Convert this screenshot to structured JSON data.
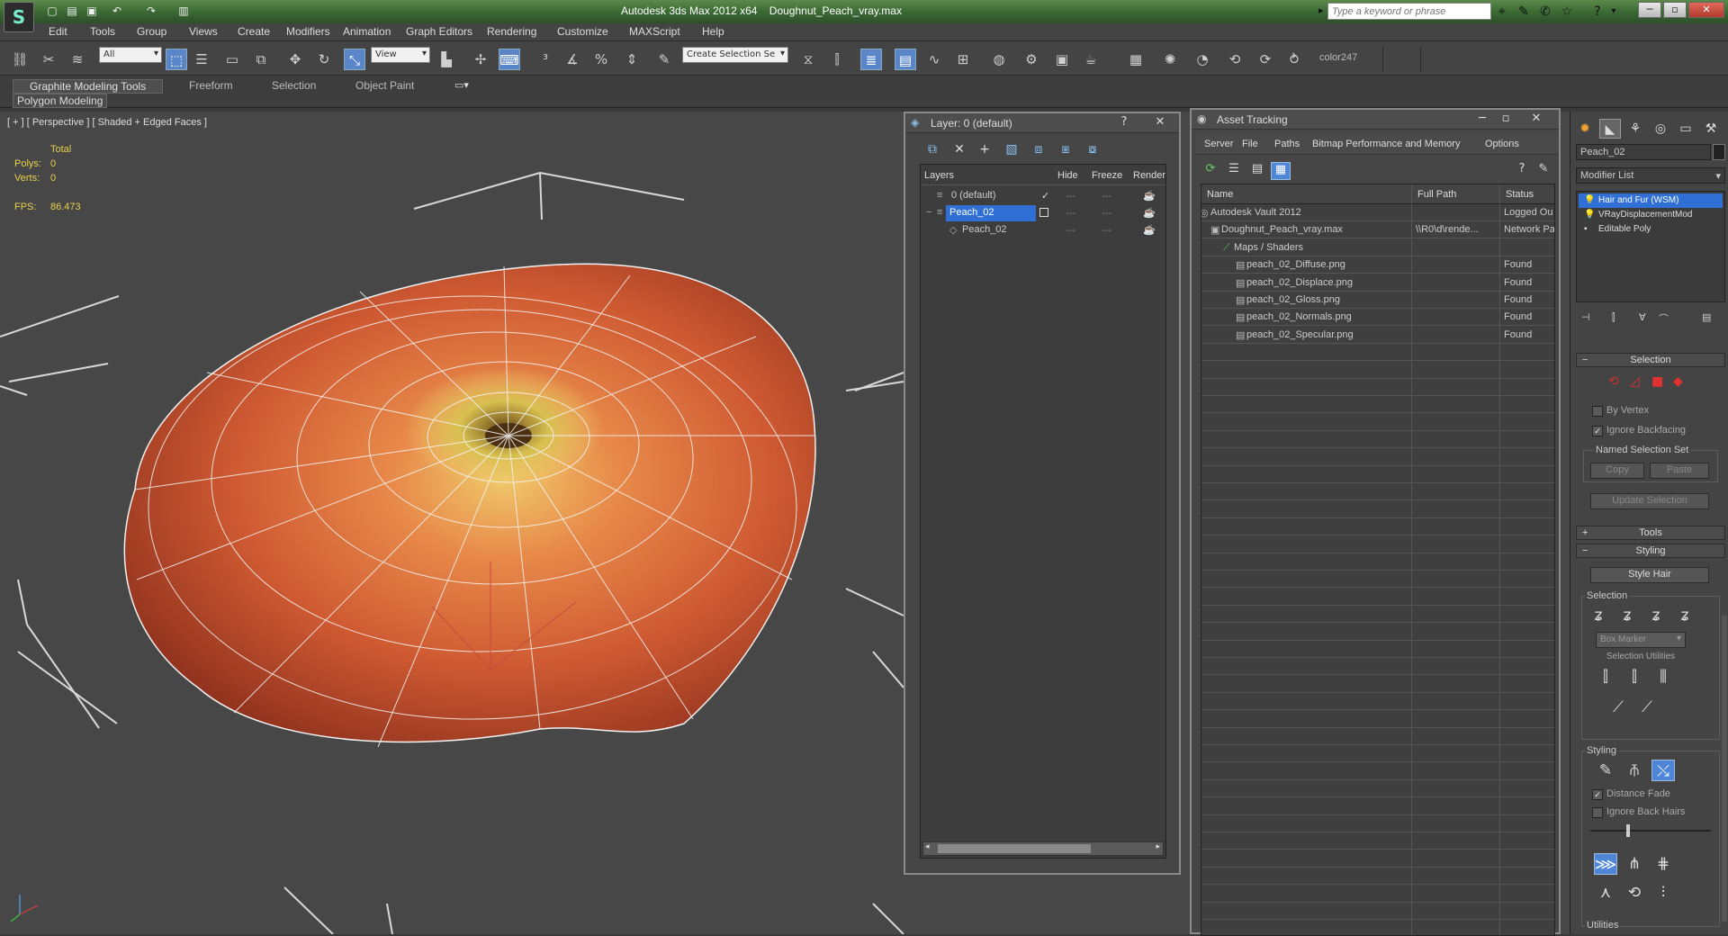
{
  "titlebar": {
    "app_title": "Autodesk 3ds Max  2012 x64",
    "file_name": "Doughnut_Peach_vray.max",
    "search_placeholder": "Type a keyword or phrase"
  },
  "menu": [
    "Edit",
    "Tools",
    "Group",
    "Views",
    "Create",
    "Modifiers",
    "Animation",
    "Graph Editors",
    "Rendering",
    "Customize",
    "MAXScript",
    "Help"
  ],
  "toolbar": {
    "selection_filter": "All",
    "ref_coord": "View",
    "named_selection": "Create Selection Se",
    "color_label": "color247"
  },
  "ribbon": {
    "tabs": [
      "Graphite Modeling Tools",
      "Freeform",
      "Selection",
      "Object Paint"
    ],
    "panel": "Polygon Modeling"
  },
  "viewport": {
    "label": "[ + ] [ Perspective ] [ Shaded + Edged Faces ]",
    "stats_header": "Total",
    "polys_label": "Polys:",
    "polys_value": "0",
    "verts_label": "Verts:",
    "verts_value": "0",
    "fps_label": "FPS:",
    "fps_value": "86.473"
  },
  "layer_dialog": {
    "title": "Layer: 0 (default)",
    "columns": [
      "Layers",
      "Hide",
      "Freeze",
      "Render"
    ],
    "rows": [
      {
        "name": "0 (default)"
      },
      {
        "name": "Peach_02"
      },
      {
        "name": "Peach_02"
      }
    ]
  },
  "asset_tracking": {
    "title": "Asset Tracking",
    "menu": [
      "Server",
      "File",
      "Paths",
      "Bitmap Performance and Memory",
      "Options"
    ],
    "columns": [
      "Name",
      "Full Path",
      "Status"
    ],
    "rows": [
      {
        "name": "Autodesk Vault 2012",
        "path": "",
        "status": "Logged Ou"
      },
      {
        "name": "Doughnut_Peach_vray.max",
        "path": "\\\\R0\\d\\rende...",
        "status": "Network Pa"
      },
      {
        "name": "Maps / Shaders",
        "path": "",
        "status": ""
      },
      {
        "name": "peach_02_Diffuse.png",
        "path": "",
        "status": "Found"
      },
      {
        "name": "peach_02_Displace.png",
        "path": "",
        "status": "Found"
      },
      {
        "name": "peach_02_Gloss.png",
        "path": "",
        "status": "Found"
      },
      {
        "name": "peach_02_Normals.png",
        "path": "",
        "status": "Found"
      },
      {
        "name": "peach_02_Specular.png",
        "path": "",
        "status": "Found"
      }
    ]
  },
  "command_panel": {
    "object_name": "Peach_02",
    "modifier_list": "Modifier List",
    "stack": [
      "Hair and Fur (WSM)",
      "VRayDisplacementMod",
      "Editable Poly"
    ],
    "selection_rollout": "Selection",
    "by_vertex": "By Vertex",
    "ignore_backfacing": "Ignore Backfacing",
    "named_sel_set": "Named Selection Set",
    "copy": "Copy",
    "paste": "Paste",
    "update_selection": "Update Selection",
    "tools_rollout": "Tools",
    "styling_rollout": "Styling",
    "style_hair": "Style Hair",
    "selection_group": "Selection",
    "box_marker": "Box Marker",
    "selection_utilities": "Selection Utilities",
    "styling_group": "Styling",
    "distance_fade": "Distance Fade",
    "ignore_back_hairs": "Ignore Back Hairs",
    "utilities_group": "Utilities"
  }
}
